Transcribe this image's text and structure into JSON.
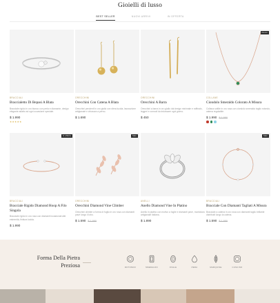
{
  "page": {
    "title": "Gioielli di lusso"
  },
  "tabs": [
    {
      "label": "Best seller"
    },
    {
      "label": "Nuovi arrivi"
    },
    {
      "label": "In offerta"
    }
  ],
  "products": [
    {
      "category": "Bracciali",
      "name": "Braccialetto Di Bepasi A Blata",
      "description": "Bracciale rigido in oro bianco con perla e diamante, design elegante adatto ad ogni occasione speciale.",
      "price": "$ 1.990",
      "old_price": "",
      "stars": "★★★★★",
      "badge": "",
      "swatches": []
    },
    {
      "category": "Orecchini",
      "name": "Orecchini Con Catena A Blata",
      "description": "Orecchini pendenti in oro giallo con sfera lucida, lavorazione artigianale e chiusura a perno.",
      "price": "$ 1.690",
      "old_price": "",
      "stars": "",
      "badge": "",
      "swatches": []
    },
    {
      "category": "Orecchini",
      "name": "Orecchini A Barra",
      "description": "Orecchini a barra in oro giallo dal design minimale e raffinato, leggeri e comodi da indossare ogni giorno.",
      "price": "$ 450",
      "old_price": "",
      "stars": "",
      "badge": "",
      "swatches": []
    },
    {
      "category": "Collane",
      "name": "Ciondolo Smeraldo Colorato A Misura",
      "description": "Collana sottile in oro rosa con ciondolo smeraldo taglio rotondo, catena regolabile.",
      "price": "$ 1.990",
      "old_price": "$ 1.990",
      "stars": "",
      "badge": "Nuovo",
      "swatches": [
        "#c0392b",
        "#2e8b57",
        "#8fd3e8"
      ]
    },
    {
      "category": "Bracciali",
      "name": "Bracciale Rigido Diamond Hoop A Filo Singola",
      "description": "Bracciale rigido in oro rosa con diamanti incastonati alle estremità, finitura lucida.",
      "price": "$ 1.990",
      "old_price": "",
      "stars": "",
      "badge": "In offerta",
      "swatches": []
    },
    {
      "category": "Orecchini",
      "name": "Orecchini Diamond Vine Climber",
      "description": "Orecchini climber a forma di foglia in oro rosa con diamanti pavé lungo il lobo.",
      "price": "$ 1.590",
      "old_price": "$ 1.990",
      "stars": "",
      "badge": "Sale",
      "swatches": []
    },
    {
      "category": "Anelli",
      "name": "Anello Diamond Vine In Platino",
      "description": "Anello in platino con motivo a foglie e diamanti pavé, montatura artigianale italiana.",
      "price": "$ 1.890",
      "old_price": "",
      "stars": "",
      "badge": "",
      "swatches": []
    },
    {
      "category": "Bracciali",
      "name": "Bracciale Con Diamanti Tagliati A Misura",
      "description": "Bracciale a catena in oro rosa con diamanti taglio brillante distribuiti lungo la catena.",
      "price": "$ 1.590",
      "old_price": "$ 1.990",
      "stars": "",
      "badge": "Sale",
      "swatches": []
    }
  ],
  "shape_section": {
    "title": "Forma Della Pietra Preziosa",
    "shapes": [
      {
        "label": "Rotondo",
        "icon": "round-cut-icon"
      },
      {
        "label": "Smeraldo",
        "icon": "emerald-cut-icon"
      },
      {
        "label": "Ovale",
        "icon": "oval-cut-icon"
      },
      {
        "label": "Pera",
        "icon": "pear-cut-icon"
      },
      {
        "label": "Marquise",
        "icon": "marquise-cut-icon"
      },
      {
        "label": "Cuscino",
        "icon": "cushion-cut-icon"
      }
    ]
  },
  "colors": {
    "accent": "#b9a06a",
    "gold": "#c9a24a",
    "rose_gold": "#d9a48a",
    "band": "#f5efe9"
  }
}
